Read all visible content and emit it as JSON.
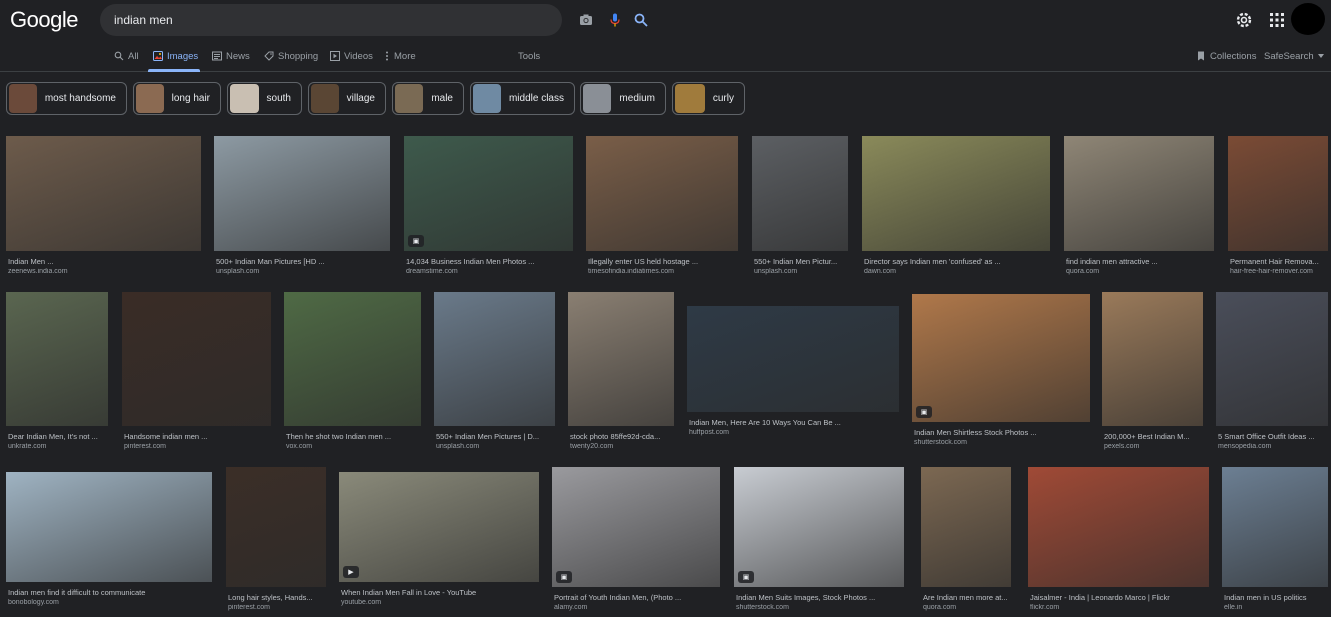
{
  "header": {
    "logo": "Google",
    "search_value": "indian men",
    "camera_icon": "camera-icon",
    "mic_icon": "mic-icon",
    "search_icon": "search-icon",
    "settings_icon": "gear-icon",
    "apps_icon": "apps-grid-icon"
  },
  "nav": {
    "tabs": [
      {
        "label": "All",
        "icon": "search-icon"
      },
      {
        "label": "Images",
        "icon": "image-icon",
        "active": true
      },
      {
        "label": "News",
        "icon": "news-icon"
      },
      {
        "label": "Shopping",
        "icon": "tag-icon"
      },
      {
        "label": "Videos",
        "icon": "play-icon"
      },
      {
        "label": "More",
        "icon": "more-vert-icon"
      }
    ],
    "tools": "Tools",
    "collections": "Collections",
    "safesearch": "SafeSearch"
  },
  "chips": [
    {
      "label": "most handsome",
      "thumb_color": "#6b4a3a"
    },
    {
      "label": "long hair",
      "thumb_color": "#8b6a52"
    },
    {
      "label": "south",
      "thumb_color": "#c9bfb2"
    },
    {
      "label": "village",
      "thumb_color": "#5a4634"
    },
    {
      "label": "male",
      "thumb_color": "#7a6a54"
    },
    {
      "label": "middle class",
      "thumb_color": "#6f8aa3"
    },
    {
      "label": "medium",
      "thumb_color": "#8a8f96"
    },
    {
      "label": "curly",
      "thumb_color": "#a07b3c"
    }
  ],
  "results": [
    {
      "title": "Indian Men ...",
      "source": "zeenews.india.com",
      "color": "#6d5b4b",
      "badge": false
    },
    {
      "title": "500+ Indian Man Pictures [HD ...",
      "source": "unsplash.com",
      "color": "#8d9aa3",
      "badge": false
    },
    {
      "title": "14,034 Business Indian Men Photos ...",
      "source": "dreamstime.com",
      "color": "#3e5a4c",
      "badge": true
    },
    {
      "title": "Illegally enter US held hostage ...",
      "source": "timesofindia.indiatimes.com",
      "color": "#7a5e48",
      "badge": false
    },
    {
      "title": "550+ Indian Men Pictur...",
      "source": "unsplash.com",
      "color": "#5c5f63",
      "badge": false
    },
    {
      "title": "Director says Indian men 'confused' as ...",
      "source": "dawn.com",
      "color": "#8a8a5a",
      "badge": false
    },
    {
      "title": "find indian men attractive ...",
      "source": "quora.com",
      "color": "#8f8676",
      "badge": false
    },
    {
      "title": "Permanent Hair Remova...",
      "source": "hair-free-hair-remover.com",
      "color": "#7b4b35",
      "badge": false
    },
    {
      "title": "Dear Indian Men, It's not ...",
      "source": "unkrate.com",
      "color": "#5a6650",
      "badge": false
    },
    {
      "title": "Handsome indian men ...",
      "source": "pinterest.com",
      "color": "#3a2c26",
      "badge": false
    },
    {
      "title": "Then he shot two Indian men ...",
      "source": "vox.com",
      "color": "#4f6a45",
      "badge": false
    },
    {
      "title": "550+ Indian Men Pictures | D...",
      "source": "unsplash.com",
      "color": "#6a7a8a",
      "badge": false
    },
    {
      "title": "stock photo 85ffe92d-cda...",
      "source": "twenty20.com",
      "color": "#8a7f72",
      "badge": false
    },
    {
      "title": "Indian Men, Here Are 10 Ways You Can Be ...",
      "source": "huffpost.com",
      "color": "#2e3a46",
      "badge": false
    },
    {
      "title": "Indian Men Shirtless Stock Photos ...",
      "source": "shutterstock.com",
      "color": "#b0784a",
      "badge": true
    },
    {
      "title": "200,000+ Best Indian M...",
      "source": "pexels.com",
      "color": "#9a7a5a",
      "badge": false
    },
    {
      "title": "5 Smart Office Outfit Ideas ...",
      "source": "mensopedia.com",
      "color": "#4a4e5a",
      "badge": false
    },
    {
      "title": "Indian men find it difficult to communicate",
      "source": "bonobology.com",
      "color": "#9fb3c2",
      "badge": false
    },
    {
      "title": "Long hair styles, Hands...",
      "source": "pinterest.com",
      "color": "#3b2e27",
      "badge": false
    },
    {
      "title": "When Indian Men Fall in Love - YouTube",
      "source": "youtube.com",
      "color": "#8a8a7a",
      "badge": "play"
    },
    {
      "title": "Portrait of Youth Indian Men, (Photo ...",
      "source": "alamy.com",
      "color": "#9a9a9e",
      "badge": true
    },
    {
      "title": "Indian Men Suits Images, Stock Photos ...",
      "source": "shutterstock.com",
      "color": "#c8ccd2",
      "badge": true
    },
    {
      "title": "Are Indian men more at...",
      "source": "quora.com",
      "color": "#7c6852",
      "badge": false
    },
    {
      "title": "Jaisalmer - India | Leonardo Marco | Flickr",
      "source": "flickr.com",
      "color": "#a04a36",
      "badge": false
    },
    {
      "title": "Indian men in US politics",
      "source": "elle.in",
      "color": "#6c7f93",
      "badge": false
    }
  ]
}
